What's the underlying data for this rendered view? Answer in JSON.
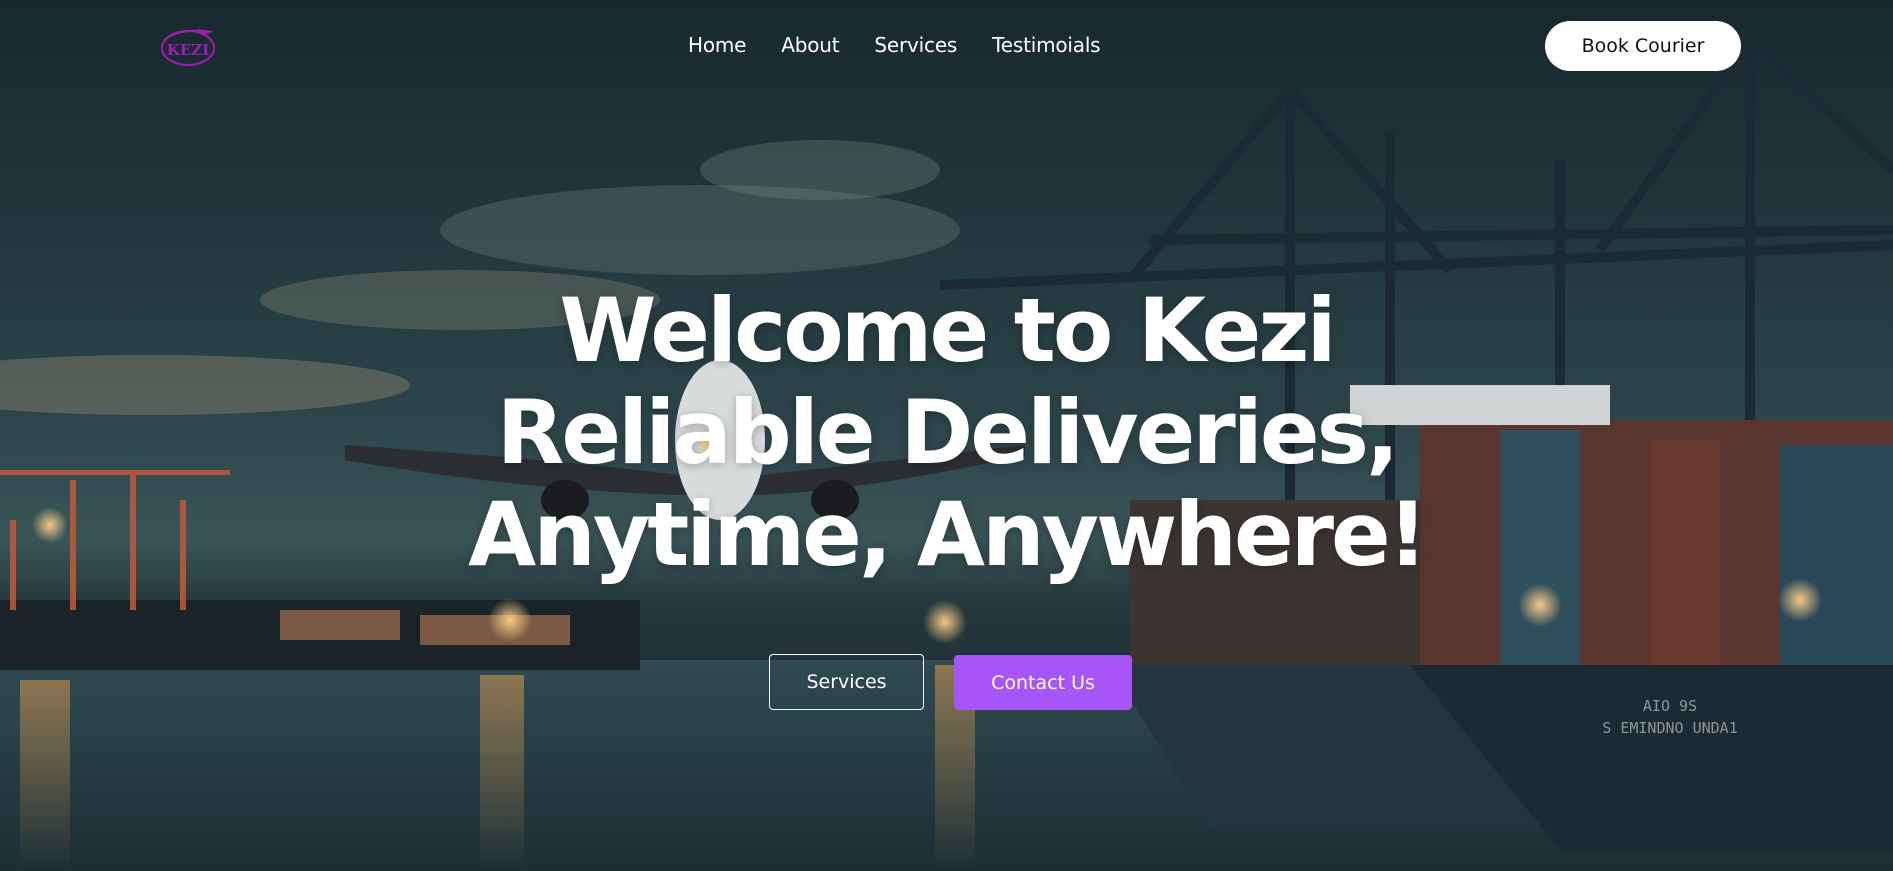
{
  "brand": {
    "logo_text": "KEZI",
    "logo_color": "#a21caf"
  },
  "nav": {
    "links": [
      {
        "label": "Home"
      },
      {
        "label": "About"
      },
      {
        "label": "Services"
      },
      {
        "label": "Testimoials"
      }
    ],
    "cta_label": "Book Courier"
  },
  "hero": {
    "headline_lines": [
      "Welcome to Kezi",
      "Reliable Deliveries,",
      "Anytime, Anywhere!"
    ],
    "primary_button": "Services",
    "secondary_button": "Contact Us",
    "accent_color": "#a855f7"
  },
  "ship_hull_text": [
    "AIO 9S",
    "S EMINDNO UNDA1"
  ]
}
